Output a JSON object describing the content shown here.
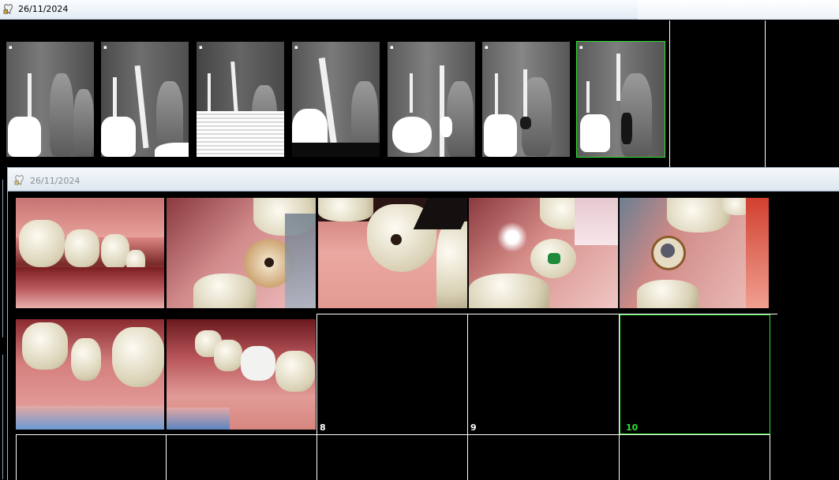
{
  "window_top": {
    "title": "26/11/2024"
  },
  "window_bottom": {
    "title": "26/11/2024"
  },
  "xray_strip": {
    "selected_index": 6,
    "selection_color": "#2fe02f",
    "count": 7
  },
  "photo_grid": {
    "selection_color": "#2fe02f",
    "slot_labels": {
      "slot8": "8",
      "slot9": "9",
      "slot10": "10"
    },
    "selected_slot": "10"
  },
  "icons": {
    "window_icon": "tooth-app-icon"
  }
}
